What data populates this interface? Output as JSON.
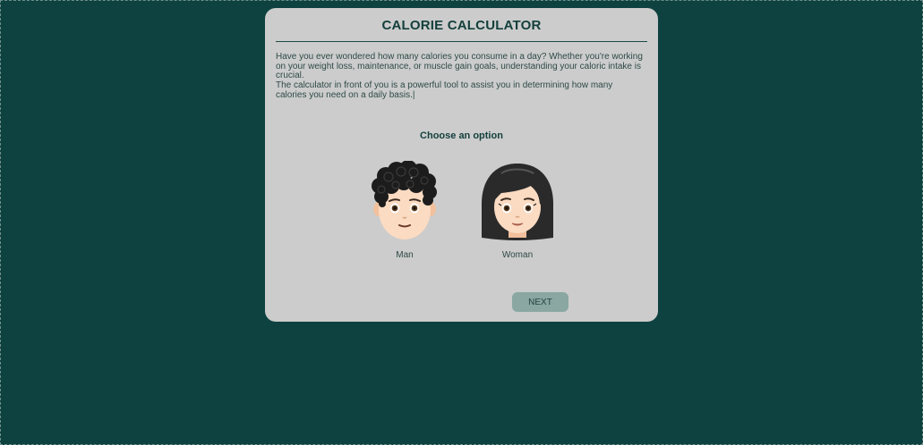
{
  "app": {
    "title": "CALORIE CALCULATOR"
  },
  "intro": {
    "paragraph1": "Have you ever wondered how many calories you consume in a day? Whether you're working on your weight loss, maintenance, or muscle gain goals, understanding your caloric intake is crucial.",
    "paragraph2": "The calculator in front of you is a powerful tool to assist you in determining how many calories you need on a daily basis.",
    "cursor": "|"
  },
  "selection": {
    "heading": "Choose an option",
    "options": [
      {
        "label": "Man",
        "icon": "man-emoji-icon"
      },
      {
        "label": "Woman",
        "icon": "woman-emoji-icon"
      }
    ]
  },
  "actions": {
    "next_label": "NEXT"
  },
  "colors": {
    "background": "#0e4240",
    "card": "#cccccc",
    "title": "#133f3b",
    "button": "#8aa7a2"
  }
}
